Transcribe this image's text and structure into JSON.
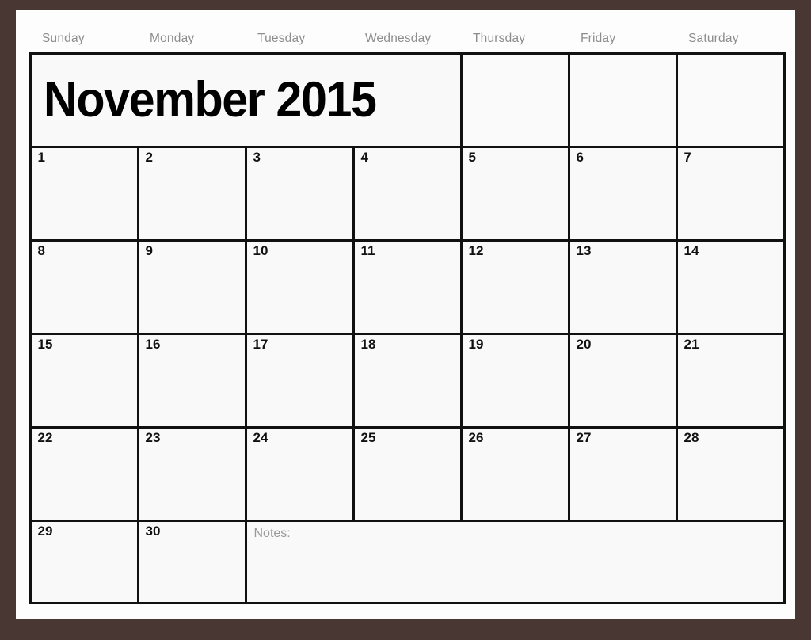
{
  "calendar": {
    "title": "November 2015",
    "month": "November",
    "year": "2015",
    "frame_color": "#493733",
    "grid_line_color": "#111111",
    "cell_background": "#f9f9f9",
    "header_text_color": "#8d8d8d",
    "daynum_color": "#111111",
    "day_headers": [
      "Sunday",
      "Monday",
      "Tuesday",
      "Wednesday",
      "Thursday",
      "Friday",
      "Saturday"
    ],
    "weeks": [
      {
        "row": 1,
        "cells": [
          {
            "kind": "title",
            "text": "November 2015",
            "span": 4
          },
          {
            "kind": "blank",
            "text": ""
          },
          {
            "kind": "blank",
            "text": ""
          },
          {
            "kind": "blank",
            "text": ""
          }
        ]
      },
      {
        "row": 2,
        "cells": [
          {
            "kind": "day",
            "text": "1"
          },
          {
            "kind": "day",
            "text": "2"
          },
          {
            "kind": "day",
            "text": "3"
          },
          {
            "kind": "day",
            "text": "4"
          },
          {
            "kind": "day",
            "text": "5"
          },
          {
            "kind": "day",
            "text": "6"
          },
          {
            "kind": "day",
            "text": "7"
          }
        ]
      },
      {
        "row": 3,
        "cells": [
          {
            "kind": "day",
            "text": "8"
          },
          {
            "kind": "day",
            "text": "9"
          },
          {
            "kind": "day",
            "text": "10"
          },
          {
            "kind": "day",
            "text": "11"
          },
          {
            "kind": "day",
            "text": "12"
          },
          {
            "kind": "day",
            "text": "13"
          },
          {
            "kind": "day",
            "text": "14"
          }
        ]
      },
      {
        "row": 4,
        "cells": [
          {
            "kind": "day",
            "text": "15"
          },
          {
            "kind": "day",
            "text": "16"
          },
          {
            "kind": "day",
            "text": "17"
          },
          {
            "kind": "day",
            "text": "18"
          },
          {
            "kind": "day",
            "text": "19"
          },
          {
            "kind": "day",
            "text": "20"
          },
          {
            "kind": "day",
            "text": "21"
          }
        ]
      },
      {
        "row": 5,
        "cells": [
          {
            "kind": "day",
            "text": "22"
          },
          {
            "kind": "day",
            "text": "23"
          },
          {
            "kind": "day",
            "text": "24"
          },
          {
            "kind": "day",
            "text": "25"
          },
          {
            "kind": "day",
            "text": "26"
          },
          {
            "kind": "day",
            "text": "27"
          },
          {
            "kind": "day",
            "text": "28"
          }
        ]
      },
      {
        "row": 6,
        "cells": [
          {
            "kind": "day",
            "text": "29"
          },
          {
            "kind": "day",
            "text": "30"
          },
          {
            "kind": "notes",
            "text": "Notes:",
            "span": 5
          }
        ]
      }
    ],
    "notes_label": "Notes:"
  }
}
